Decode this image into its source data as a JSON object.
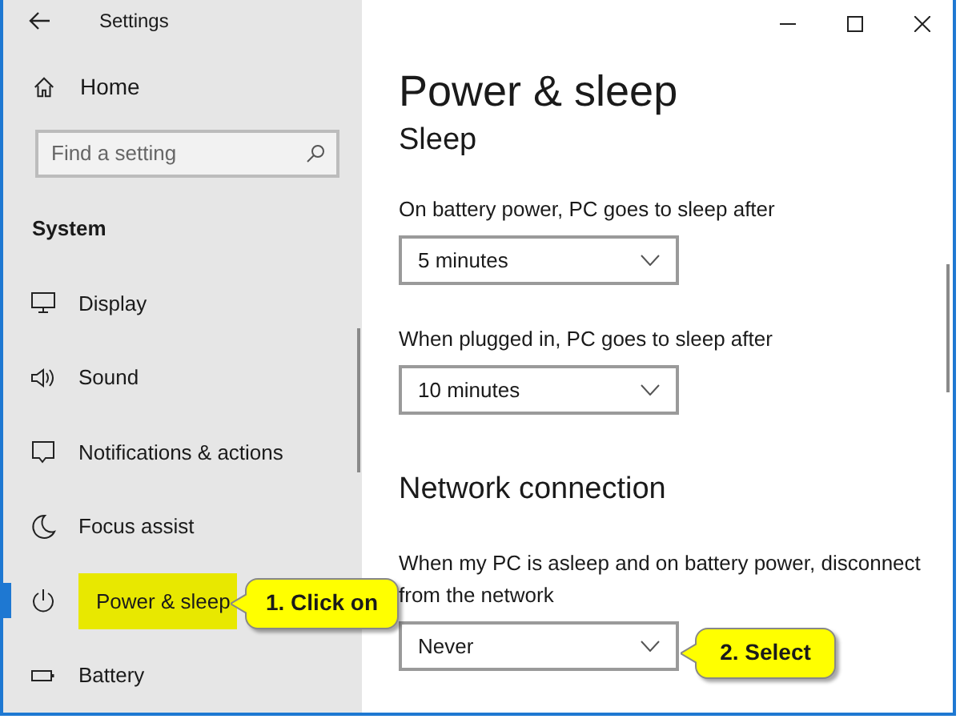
{
  "window": {
    "title": "Settings"
  },
  "sidebar": {
    "home": "Home",
    "search": {
      "placeholder": "Find a setting"
    },
    "section": "System",
    "items": [
      {
        "label": "Display",
        "selected": false
      },
      {
        "label": "Sound",
        "selected": false
      },
      {
        "label": "Notifications & actions",
        "selected": false
      },
      {
        "label": "Focus assist",
        "selected": false
      },
      {
        "label": "Power & sleep",
        "selected": true,
        "highlighted": true
      },
      {
        "label": "Battery",
        "selected": false
      }
    ]
  },
  "page": {
    "title": "Power & sleep",
    "sections": [
      {
        "heading": "Sleep",
        "settings": [
          {
            "label": "On battery power, PC goes to sleep after",
            "value": "5 minutes"
          },
          {
            "label": "When plugged in, PC goes to sleep after",
            "value": "10 minutes"
          }
        ]
      },
      {
        "heading": "Network connection",
        "settings": [
          {
            "label": "When my PC is asleep and on battery power, disconnect from the network",
            "value": "Never"
          }
        ]
      }
    ]
  },
  "callouts": [
    {
      "text": "1. Click on"
    },
    {
      "text": "2. Select"
    }
  ]
}
